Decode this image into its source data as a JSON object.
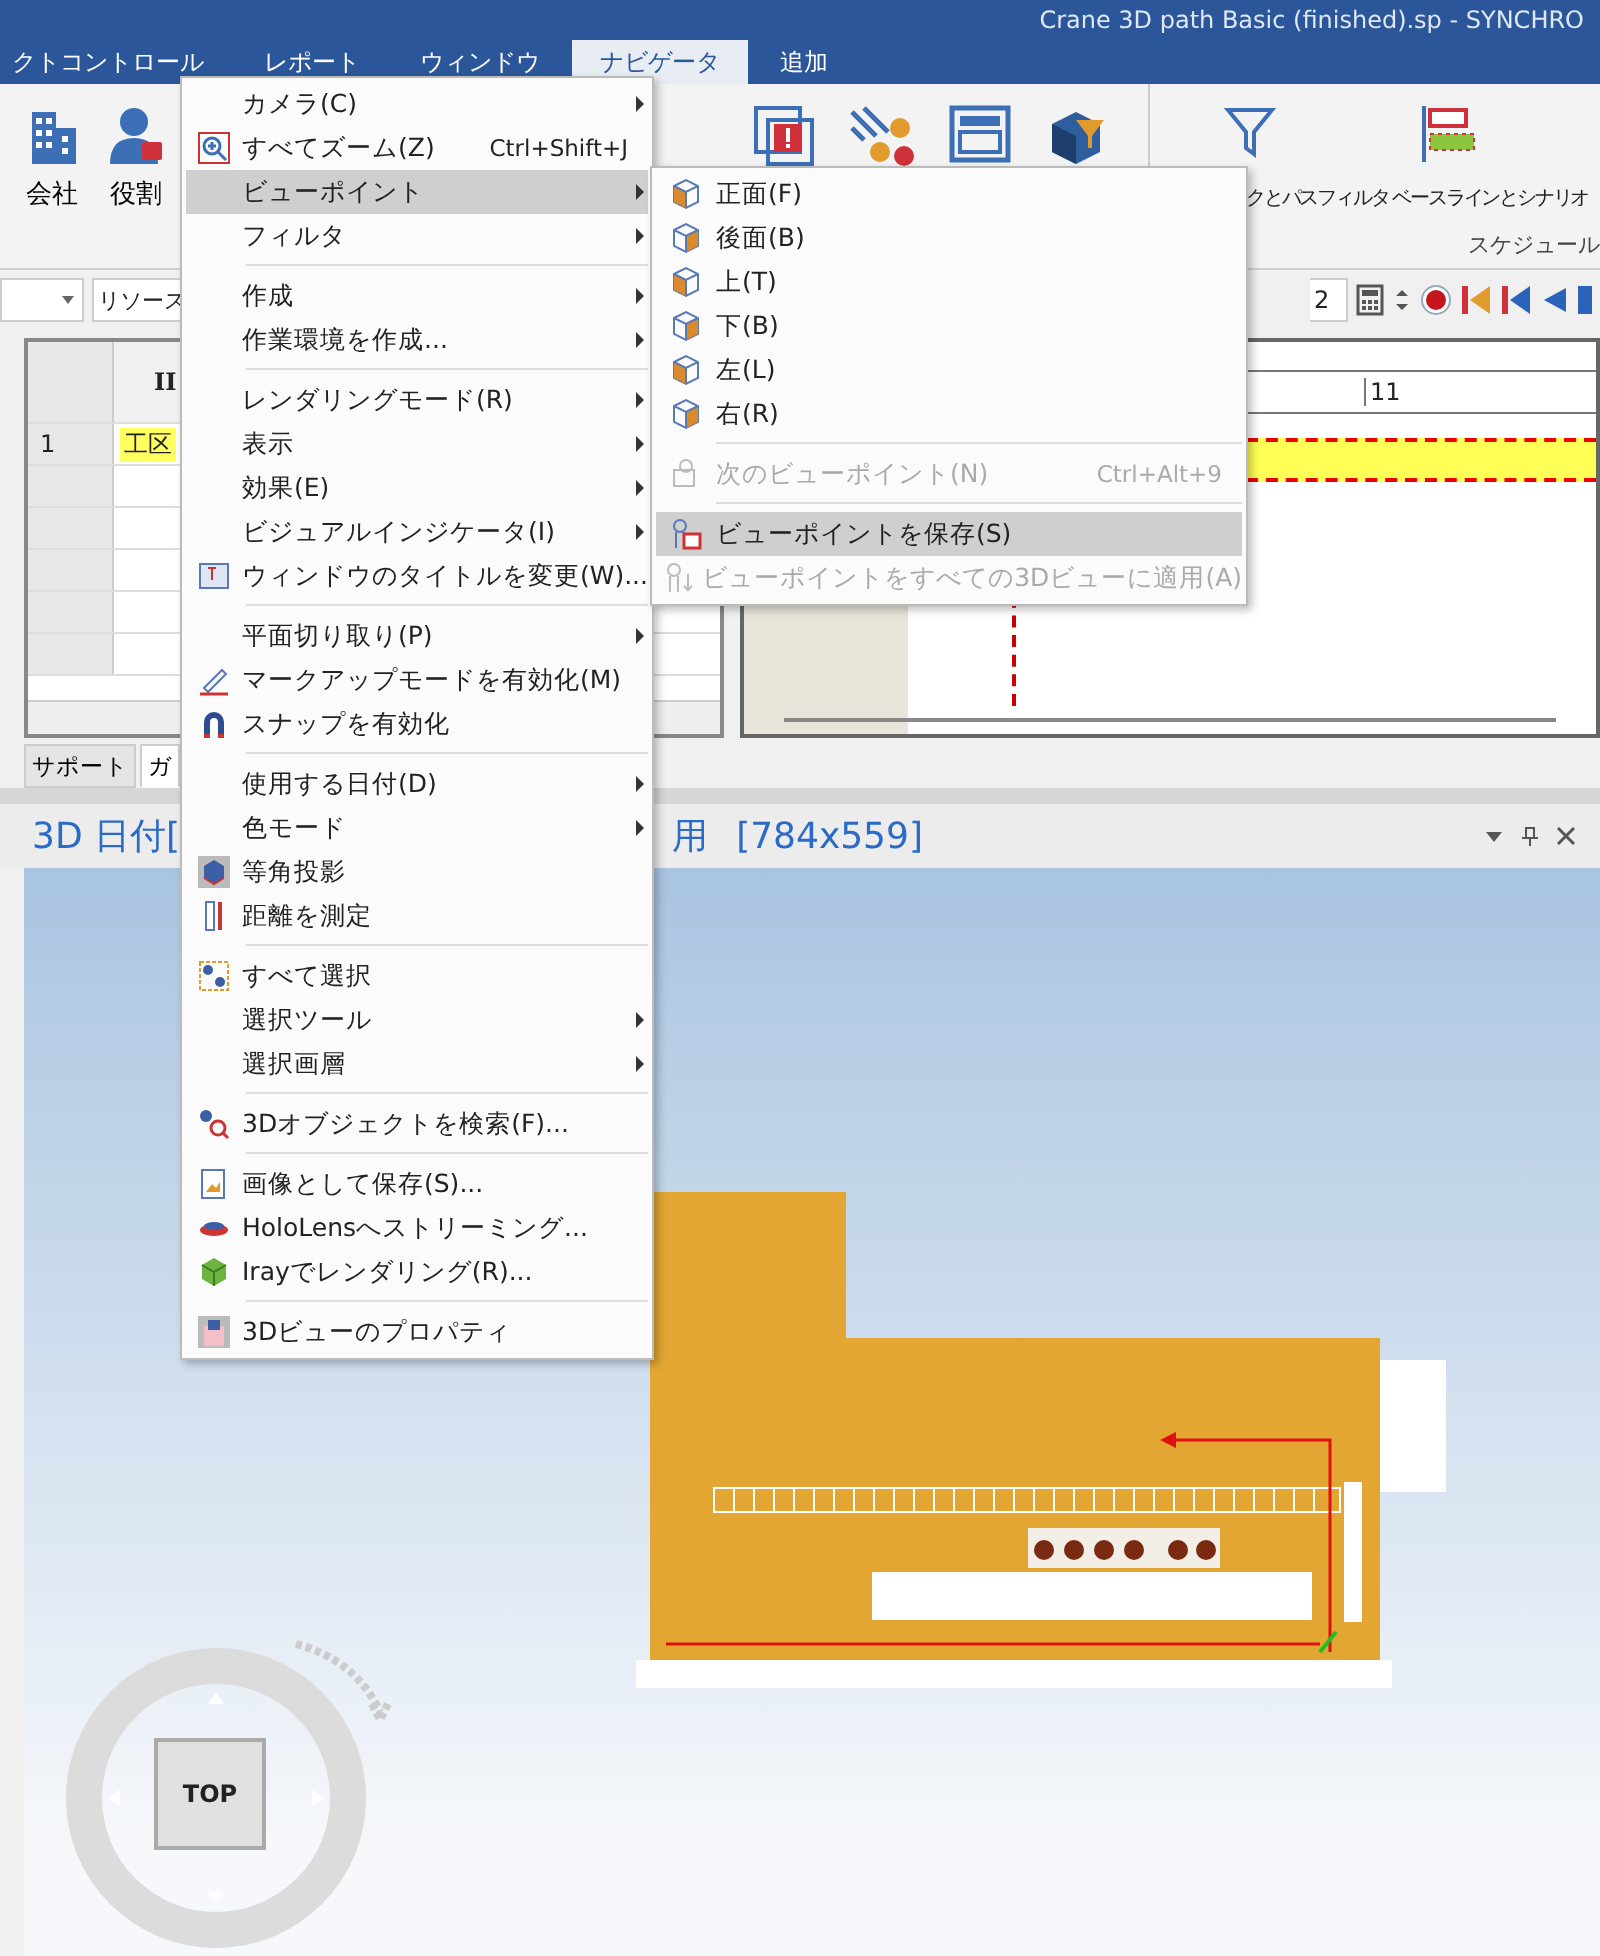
{
  "window": {
    "title": "Crane 3D path Basic (finished).sp - SYNCHRO"
  },
  "menu_bar": [
    {
      "label": "クトコントロール",
      "selected": false
    },
    {
      "label": "レポート",
      "selected": false
    },
    {
      "label": "ウィンドウ",
      "selected": false
    },
    {
      "label": "ナビゲータ",
      "selected": true
    },
    {
      "label": "追加",
      "selected": false
    }
  ],
  "ribbon": {
    "left_buttons": [
      {
        "label": "会社"
      },
      {
        "label": "役割"
      }
    ],
    "right_buttons": [
      {
        "label": "クとパスフィルタ"
      },
      {
        "label": "ベースラインとシナリオ"
      }
    ],
    "group_label": "スケジュール"
  },
  "toolbar": {
    "resource_dropdown": "リソース",
    "date_field": "2"
  },
  "grid": {
    "header": "II",
    "rows": [
      {
        "number": "1",
        "name": "工区"
      }
    ]
  },
  "gantt": {
    "header": "11"
  },
  "bottom_tabs": [
    {
      "label": "サポート",
      "selected": false
    },
    {
      "label": "ガ",
      "selected": true
    }
  ],
  "view_panel": {
    "title_left": "3D 日付[",
    "title_right": "用",
    "size": "[784x559]"
  },
  "nav_cube": {
    "label": "TOP"
  },
  "menu": {
    "items": [
      {
        "kind": "item",
        "label": "カメラ(C)",
        "submenu": true,
        "selected": false
      },
      {
        "kind": "item",
        "label": "すべてズーム(Z)",
        "shortcut": "Ctrl+Shift+J",
        "submenu": false,
        "selected": false
      },
      {
        "kind": "item",
        "label": "ビューポイント",
        "submenu": true,
        "selected": true
      },
      {
        "kind": "item",
        "label": "フィルタ",
        "submenu": true,
        "selected": false
      },
      {
        "kind": "separator"
      },
      {
        "kind": "item",
        "label": "作成",
        "submenu": true,
        "selected": false
      },
      {
        "kind": "item",
        "label": "作業環境を作成...",
        "submenu": true,
        "selected": false
      },
      {
        "kind": "separator"
      },
      {
        "kind": "item",
        "label": "レンダリングモード(R)",
        "submenu": true,
        "selected": false
      },
      {
        "kind": "item",
        "label": "表示",
        "submenu": true,
        "selected": false
      },
      {
        "kind": "item",
        "label": "効果(E)",
        "submenu": true,
        "selected": false
      },
      {
        "kind": "item",
        "label": "ビジュアルインジケータ(I)",
        "submenu": true,
        "selected": false
      },
      {
        "kind": "item",
        "label": "ウィンドウのタイトルを変更(W)...",
        "submenu": false,
        "selected": false
      },
      {
        "kind": "separator"
      },
      {
        "kind": "item",
        "label": "平面切り取り(P)",
        "submenu": true,
        "selected": false
      },
      {
        "kind": "item",
        "label": "マークアップモードを有効化(M)",
        "submenu": false,
        "selected": false
      },
      {
        "kind": "item",
        "label": "スナップを有効化",
        "submenu": false,
        "selected": false
      },
      {
        "kind": "separator"
      },
      {
        "kind": "item",
        "label": "使用する日付(D)",
        "submenu": true,
        "selected": false
      },
      {
        "kind": "item",
        "label": "色モード",
        "submenu": true,
        "selected": false
      },
      {
        "kind": "item",
        "label": "等角投影",
        "submenu": false,
        "selected": false
      },
      {
        "kind": "item",
        "label": "距離を測定",
        "submenu": false,
        "selected": false
      },
      {
        "kind": "separator"
      },
      {
        "kind": "item",
        "label": "すべて選択",
        "submenu": false,
        "selected": false
      },
      {
        "kind": "item",
        "label": "選択ツール",
        "submenu": true,
        "selected": false
      },
      {
        "kind": "item",
        "label": "選択画層",
        "submenu": true,
        "selected": false
      },
      {
        "kind": "separator"
      },
      {
        "kind": "item",
        "label": "3Dオブジェクトを検索(F)...",
        "submenu": false,
        "selected": false
      },
      {
        "kind": "separator"
      },
      {
        "kind": "item",
        "label": "画像として保存(S)...",
        "submenu": false,
        "selected": false
      },
      {
        "kind": "item",
        "label": "HoloLensへストリーミング...",
        "submenu": false,
        "selected": false
      },
      {
        "kind": "item",
        "label": "Irayでレンダリング(R)...",
        "submenu": false,
        "selected": false
      },
      {
        "kind": "separator"
      },
      {
        "kind": "item",
        "label": "3Dビューのプロパティ",
        "submenu": false,
        "selected": false
      }
    ]
  },
  "submenu": {
    "items": [
      {
        "kind": "item",
        "label": "正面(F)",
        "disabled": false,
        "selected": false
      },
      {
        "kind": "item",
        "label": "後面(B)",
        "disabled": false,
        "selected": false
      },
      {
        "kind": "item",
        "label": "上(T)",
        "disabled": false,
        "selected": false
      },
      {
        "kind": "item",
        "label": "下(B)",
        "disabled": false,
        "selected": false
      },
      {
        "kind": "item",
        "label": "左(L)",
        "disabled": false,
        "selected": false
      },
      {
        "kind": "item",
        "label": "右(R)",
        "disabled": false,
        "selected": false
      },
      {
        "kind": "separator"
      },
      {
        "kind": "item",
        "label": "次のビューポイント(N)",
        "shortcut": "Ctrl+Alt+9",
        "disabled": true,
        "selected": false
      },
      {
        "kind": "separator"
      },
      {
        "kind": "item",
        "label": "ビューポイントを保存(S)",
        "disabled": false,
        "selected": true
      },
      {
        "kind": "item",
        "label": "ビューポイントをすべての3Dビューに適用(A)",
        "disabled": true,
        "selected": false
      }
    ]
  }
}
